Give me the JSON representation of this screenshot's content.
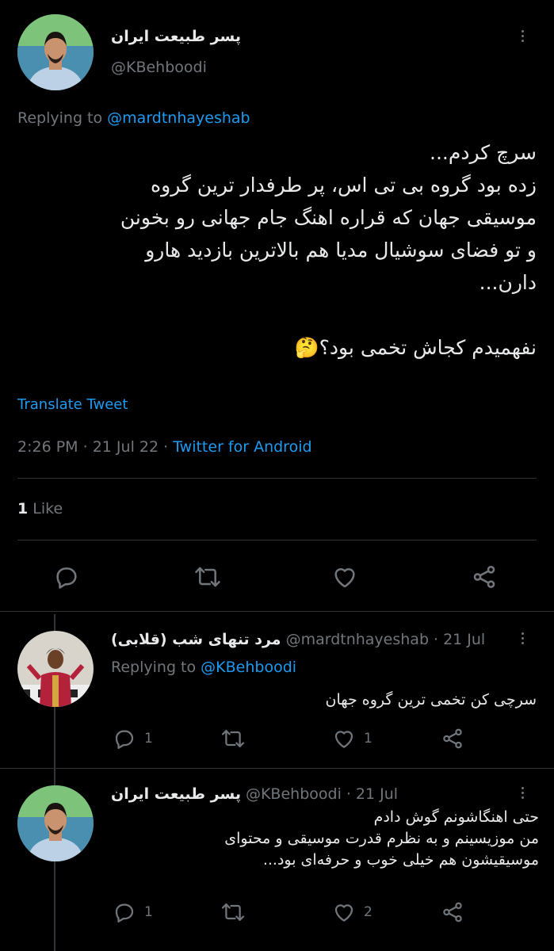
{
  "main_tweet": {
    "display_name": "پسر طبیعت ایران",
    "handle": "@KBehboodi",
    "replying_prefix": "Replying to",
    "replying_to": "@mardtnhayeshab",
    "text_lines": [
      "سرچ کردم...",
      "زده بود گروه بی تی اس، پر طرفدار ترین گروه",
      "موسیقی جهان که قراره اهنگ جام جهانی رو بخونن",
      "و تو فضای سوشیال مدیا هم بالاترین بازدید هارو",
      "دارن...",
      "نفهمیدم کجاش تخمی بود؟🤔"
    ],
    "translate": "Translate Tweet",
    "time": "2:26 PM",
    "date": "21 Jul 22",
    "separator": "·",
    "source": "Twitter for Android",
    "likes_count": "1",
    "likes_label": "Like"
  },
  "replies": [
    {
      "display_name": "مرد تنهای شب (قلابی)",
      "handle": "@mardtnhayeshab",
      "dot": "·",
      "date": "21 Jul",
      "replying_prefix": "Replying to",
      "replying_to": "@KBehboodi",
      "text_lines": [
        "سرچی کن تخمی ترین گروه جهان"
      ],
      "reply_count": "1",
      "retweet_count": "",
      "like_count": "1"
    },
    {
      "display_name": "پسر طبیعت ایران",
      "handle": "@KBehboodi",
      "dot": "·",
      "date": "21 Jul",
      "text_lines": [
        "حتی اهنگاشونم گوش دادم",
        "من موزیسینم و به نظرم قدرت موسیقی و محتوای",
        "موسیقیشون هم خیلی خوب و حرفه‌ای بود..."
      ],
      "reply_count": "1",
      "retweet_count": "",
      "like_count": "2"
    }
  ],
  "icons": [
    "more-icon",
    "reply-icon",
    "retweet-icon",
    "like-icon",
    "share-icon"
  ],
  "colors": {
    "background": "#000000",
    "text": "#e7e9ea",
    "muted": "#71767b",
    "link": "#1d9bf0",
    "divider": "#2f3336"
  }
}
